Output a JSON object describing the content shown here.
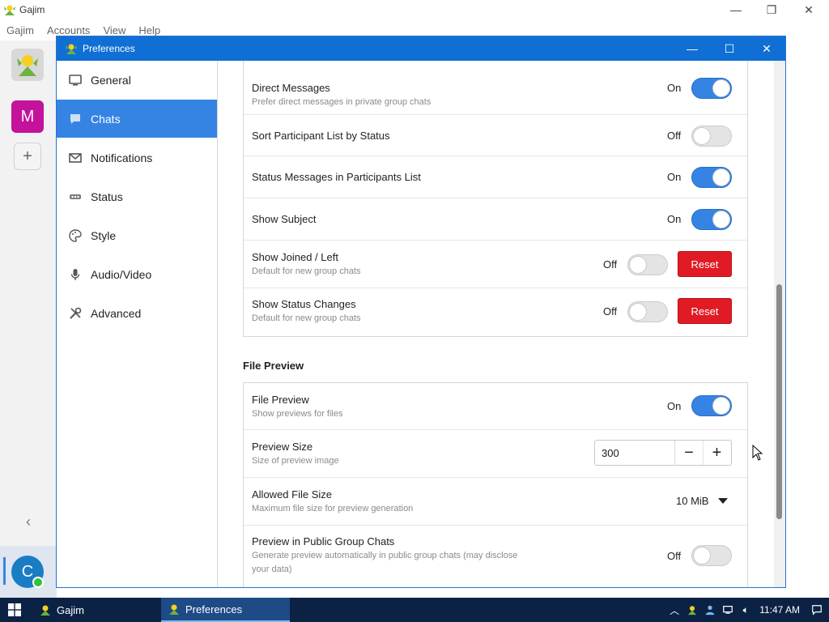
{
  "main_window": {
    "title": "Gajim",
    "menu": [
      "Gajim",
      "Accounts",
      "View",
      "Help"
    ],
    "accounts": [
      {
        "initial": "M",
        "color": "#c4129c"
      },
      {
        "initial": "C",
        "color": "#1a7dc4"
      }
    ],
    "add_label": "+",
    "collapse_icon": "chevron-left-icon"
  },
  "dialog": {
    "title": "Preferences"
  },
  "sidebar": {
    "items": [
      {
        "label": "General",
        "icon": "monitor-icon"
      },
      {
        "label": "Chats",
        "icon": "chat-bubble-icon"
      },
      {
        "label": "Notifications",
        "icon": "envelope-icon"
      },
      {
        "label": "Status",
        "icon": "dots-icon"
      },
      {
        "label": "Style",
        "icon": "palette-icon"
      },
      {
        "label": "Audio/Video",
        "icon": "microphone-icon"
      },
      {
        "label": "Advanced",
        "icon": "tools-icon"
      }
    ],
    "active": "Chats"
  },
  "group_chat_settings": [
    {
      "label": "Direct Messages",
      "sub": "Prefer direct messages in private group chats",
      "state": "On",
      "on": true
    },
    {
      "label": "Sort Participant List by Status",
      "sub": "",
      "state": "Off",
      "on": false
    },
    {
      "label": "Status Messages in Participants List",
      "sub": "",
      "state": "On",
      "on": true
    },
    {
      "label": "Show Subject",
      "sub": "",
      "state": "On",
      "on": true
    },
    {
      "label": "Show Joined / Left",
      "sub": "Default for new group chats",
      "state": "Off",
      "on": false,
      "reset": "Reset"
    },
    {
      "label": "Show Status Changes",
      "sub": "Default for new group chats",
      "state": "Off",
      "on": false,
      "reset": "Reset"
    }
  ],
  "file_preview_section": {
    "title": "File Preview",
    "rows": {
      "file_preview": {
        "label": "File Preview",
        "sub": "Show previews for files",
        "state": "On"
      },
      "preview_size": {
        "label": "Preview Size",
        "sub": "Size of preview image",
        "value": "300",
        "minus": "−",
        "plus": "+"
      },
      "allowed_file_size": {
        "label": "Allowed File Size",
        "sub": "Maximum file size for preview generation",
        "value": "10 MiB"
      },
      "public_preview": {
        "label": "Preview in Public Group Chats",
        "sub": "Generate preview automatically in public group chats (may disclose your data)",
        "state": "Off"
      }
    }
  },
  "taskbar": {
    "items": [
      "Gajim",
      "Preferences"
    ],
    "time": "11:47 AM"
  },
  "colors": {
    "accent": "#3584e4",
    "titlebar": "#0f6fd4",
    "reset": "#e01b24",
    "taskbar": "#0c2245"
  }
}
